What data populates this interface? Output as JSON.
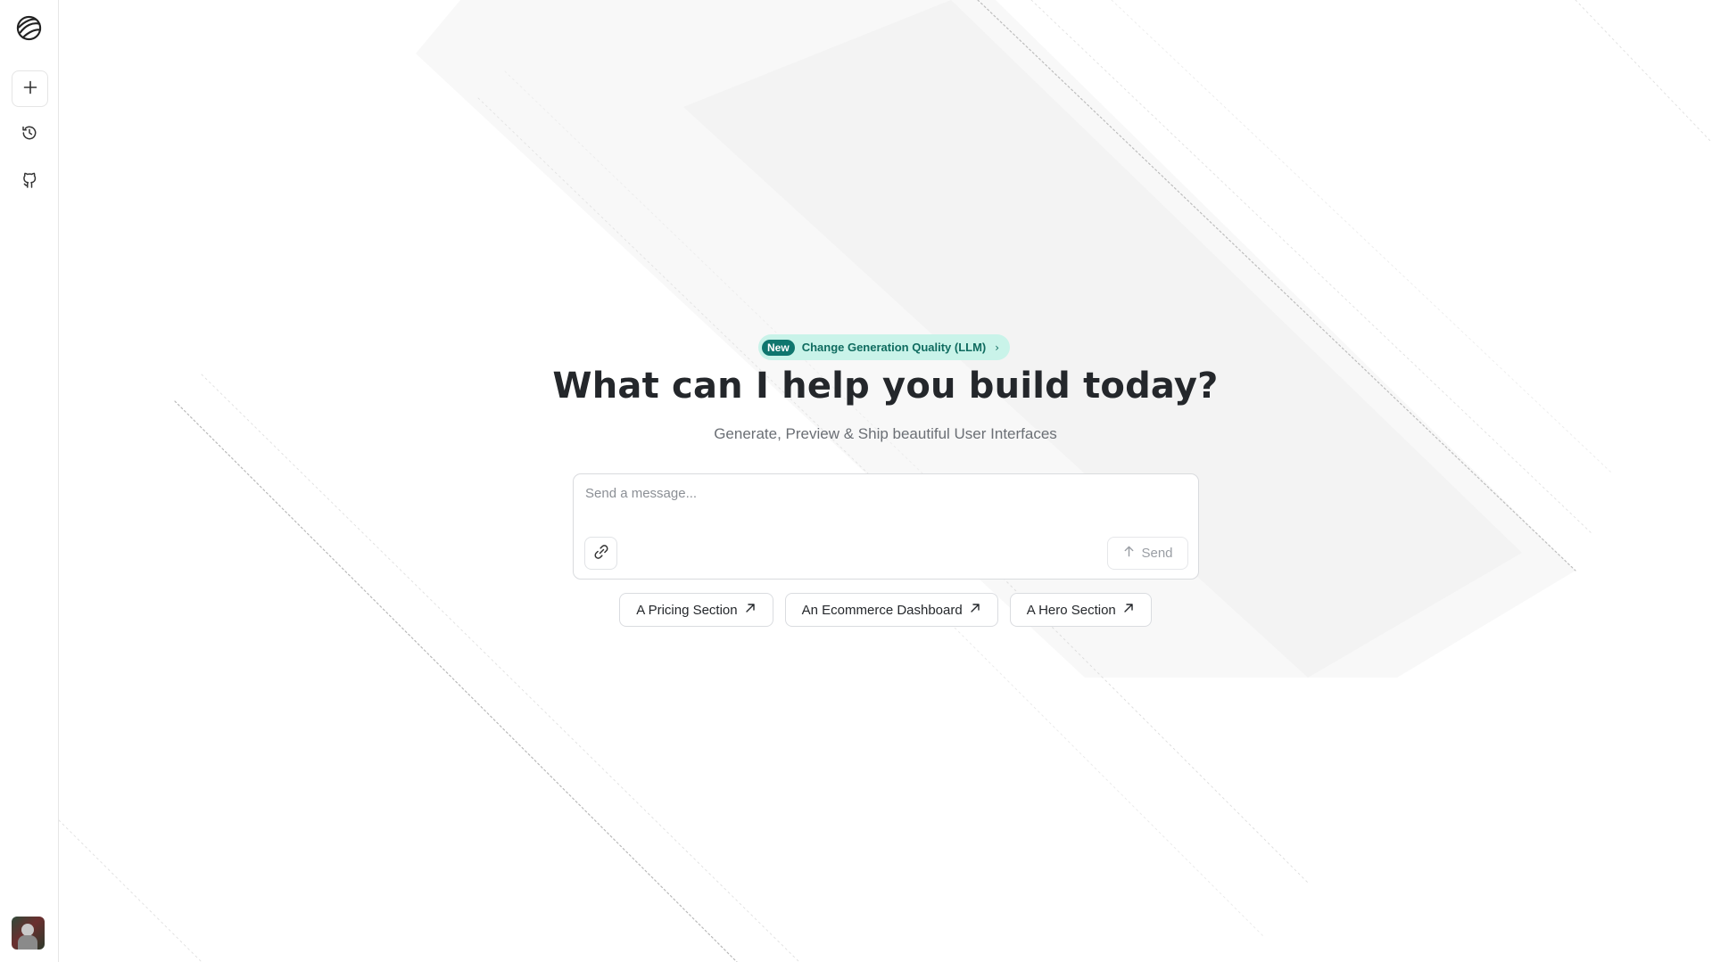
{
  "sidebar": {
    "logo_icon": "globe-logo-icon",
    "items": [
      {
        "name": "new-chat",
        "icon": "plus-icon"
      },
      {
        "name": "history",
        "icon": "history-icon"
      },
      {
        "name": "github",
        "icon": "github-icon"
      }
    ],
    "avatar_icon": "user-avatar"
  },
  "announcement": {
    "tag": "New",
    "text": "Change Generation Quality (LLM)",
    "chevron": "›"
  },
  "hero": {
    "title": "What can I help you build today?",
    "subtitle": "Generate, Preview & Ship beautiful User Interfaces"
  },
  "composer": {
    "placeholder": "Send a message...",
    "value": "",
    "attach_icon": "paperclip-icon",
    "send_label": "Send",
    "send_icon": "arrow-up-icon"
  },
  "suggestions": [
    {
      "label": "A Pricing Section",
      "icon": "arrow-up-right-icon"
    },
    {
      "label": "An Ecommerce Dashboard",
      "icon": "arrow-up-right-icon"
    },
    {
      "label": "A Hero Section",
      "icon": "arrow-up-right-icon"
    }
  ],
  "colors": {
    "accent": "#0f766e",
    "badge_bg": "#c9f3e9",
    "text_primary": "#24272b",
    "text_muted": "#6b6f75"
  }
}
